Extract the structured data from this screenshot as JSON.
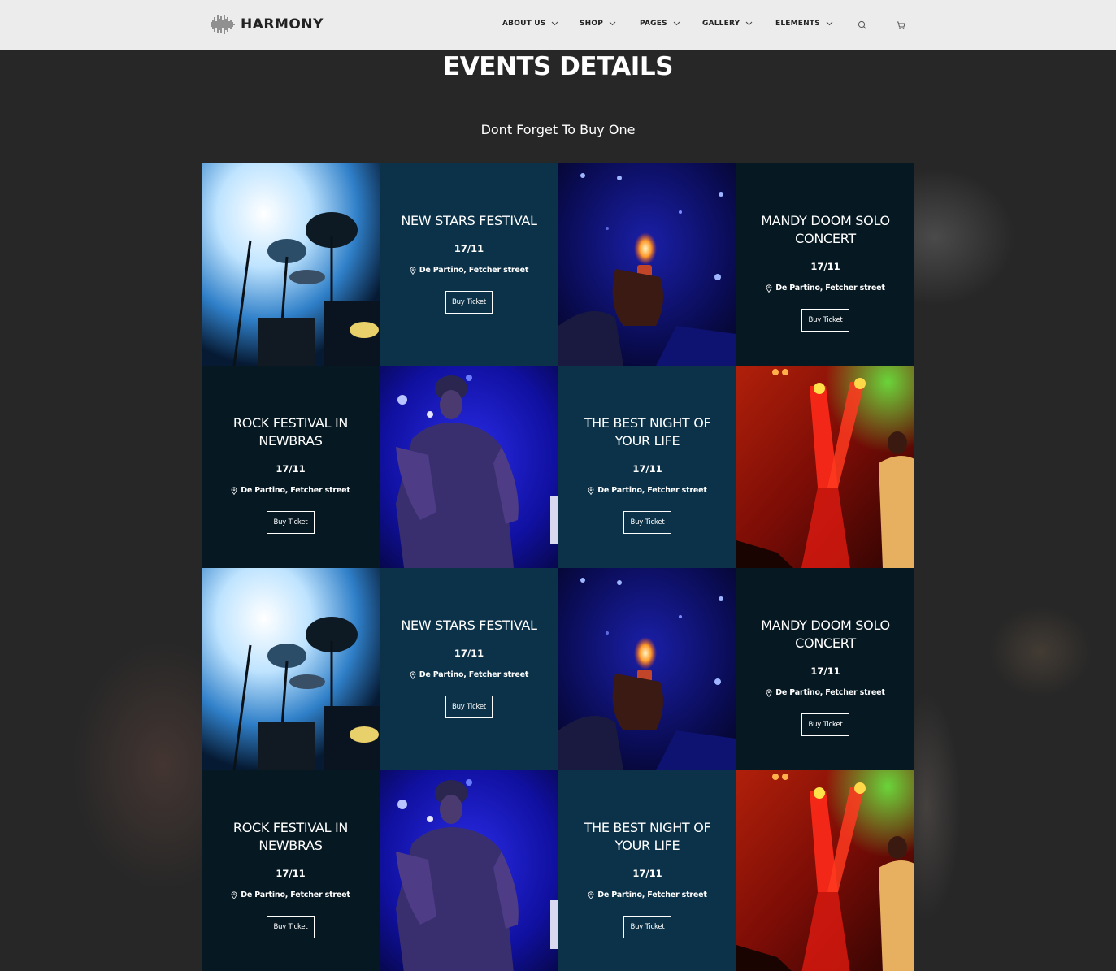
{
  "brand": {
    "name": "HARMONY"
  },
  "nav": {
    "items": [
      {
        "label": "ABOUT US"
      },
      {
        "label": "SHOP"
      },
      {
        "label": "PAGES"
      },
      {
        "label": "GALLERY"
      },
      {
        "label": "ELEMENTS"
      }
    ],
    "search_icon": "search-icon",
    "cart_icon": "cart-icon"
  },
  "page": {
    "title": "EVENTS DETAILS",
    "subtitle": "Dont Forget To Buy One"
  },
  "events": [
    {
      "title": "NEW STARS FESTIVAL",
      "date": "17/11",
      "location": "De Partino, Fetcher street",
      "button": "Buy Ticket"
    },
    {
      "title": "MANDY DOOM SOLO CONCERT",
      "date": "17/11",
      "location": "De Partino, Fetcher street",
      "button": "Buy Ticket"
    },
    {
      "title": "ROCK FESTIVAL IN NEWBRAS",
      "date": "17/11",
      "location": "De Partino, Fetcher street",
      "button": "Buy Ticket"
    },
    {
      "title": "THE BEST NIGHT OF YOUR LIFE",
      "date": "17/11",
      "location": "De Partino, Fetcher street",
      "button": "Buy Ticket"
    },
    {
      "title": "NEW STARS FESTIVAL",
      "date": "17/11",
      "location": "De Partino, Fetcher street",
      "button": "Buy Ticket"
    },
    {
      "title": "MANDY DOOM SOLO CONCERT",
      "date": "17/11",
      "location": "De Partino, Fetcher street",
      "button": "Buy Ticket"
    },
    {
      "title": "ROCK FESTIVAL IN NEWBRAS",
      "date": "17/11",
      "location": "De Partino, Fetcher street",
      "button": "Buy Ticket"
    },
    {
      "title": "THE BEST NIGHT OF YOUR LIFE",
      "date": "17/11",
      "location": "De Partino, Fetcher street",
      "button": "Buy Ticket"
    }
  ],
  "colors": {
    "header_bg": "#ececec",
    "page_bg": "#272727",
    "card_light": "#0b3248",
    "card_dark": "#061822"
  }
}
